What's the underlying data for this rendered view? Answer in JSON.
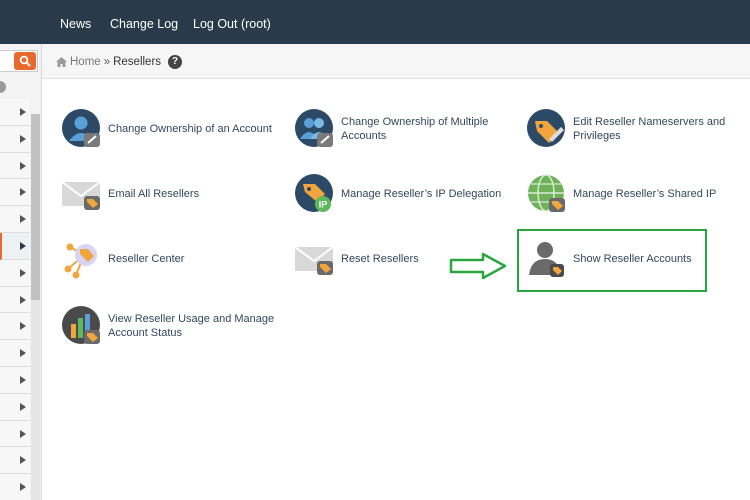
{
  "topnav": {
    "news": "News",
    "changelog": "Change Log",
    "logout": "Log Out (root)"
  },
  "breadcrumb": {
    "home": "Home",
    "separator": "»",
    "current": "Resellers",
    "help": "?"
  },
  "features": [
    {
      "label": "Change Ownership of an Account"
    },
    {
      "label": "Change Ownership of Multiple Accounts"
    },
    {
      "label": "Edit Reseller Nameservers and Privileges"
    },
    {
      "label": "Email All Resellers"
    },
    {
      "label": "Manage Reseller’s IP Delegation"
    },
    {
      "label": "Manage Reseller’s Shared IP"
    },
    {
      "label": "Reseller Center"
    },
    {
      "label": "Reset Resellers"
    },
    {
      "label": "Show Reseller Accounts"
    },
    {
      "label": "View Reseller Usage and Manage Account Status"
    }
  ],
  "colors": {
    "topbar": "#293a4a",
    "accent": "#e8692c",
    "link": "#33485e",
    "highlight": "#2aa640"
  }
}
